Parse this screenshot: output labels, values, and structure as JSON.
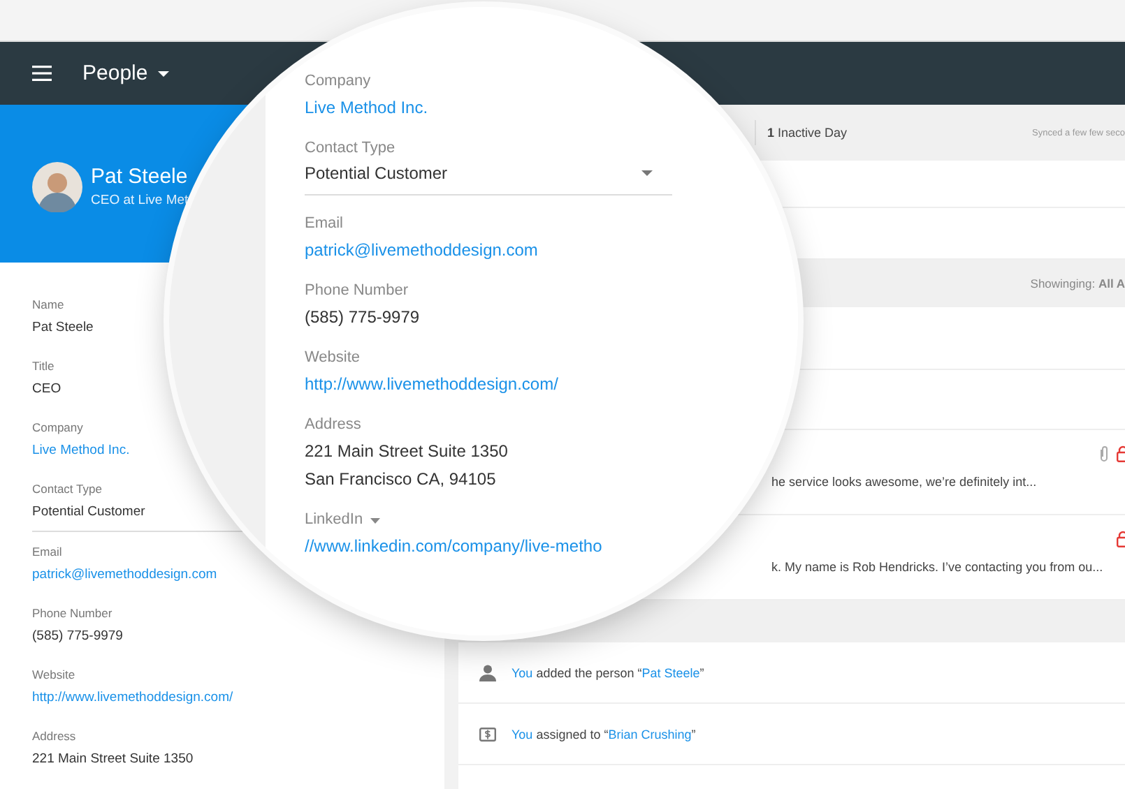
{
  "header": {
    "title": "People"
  },
  "profile": {
    "name": "Pat Steele",
    "subtitle": "CEO at Live Met"
  },
  "fields": [
    {
      "label": "Name",
      "kind": "text",
      "value": "Pat Steele"
    },
    {
      "label": "Title",
      "kind": "text",
      "value": "CEO"
    },
    {
      "label": "Company",
      "kind": "link",
      "value": "Live Method Inc."
    },
    {
      "label": "Contact Type",
      "kind": "select",
      "value": "Potential Customer"
    },
    {
      "label": "Email",
      "kind": "link",
      "value": "patrick@livemethoddesign.com"
    },
    {
      "label": "Phone Number",
      "kind": "text",
      "value": "(585) 775-9979"
    },
    {
      "label": "Website",
      "kind": "link",
      "value": "http://www.livemethoddesign.com/"
    },
    {
      "label": "Address",
      "kind": "text",
      "value": "221 Main Street Suite 1350"
    }
  ],
  "status_strip": {
    "inactive_count": "1",
    "inactive_label": "Inactive Day",
    "sync": "Synced a few few seco"
  },
  "filter": {
    "text": "Showinging: **All A**"
  },
  "messages": [
    {
      "preview": "he service looks awesome, we’re definitely int...",
      "attachment": true,
      "locked": true
    },
    {
      "preview": "k. My name is Rob Hendricks. I’ve contacting you from ou...",
      "attachment": false,
      "locked": true
    }
  ],
  "activity": [
    {
      "kind": "person",
      "actor": "You",
      "action": "added the person “",
      "target": "Pat Steele",
      "after": "”"
    },
    {
      "kind": "deal",
      "actor": "You",
      "action": "assigned to “",
      "target": "Brian Crushing",
      "after": "”"
    }
  ],
  "magnifier": {
    "fields": [
      {
        "label": "Company",
        "kind": "link",
        "value": "Live Method Inc."
      },
      {
        "label": "Contact Type",
        "kind": "select",
        "value": "Potential Customer"
      },
      {
        "label": "Email",
        "kind": "link",
        "value": "patrick@livemethoddesign.com"
      },
      {
        "label": "Phone Number",
        "kind": "text",
        "value": "(585) 775-9979"
      },
      {
        "label": "Website",
        "kind": "link",
        "value": "http://www.livemethoddesign.com/"
      },
      {
        "label": "Address",
        "kind": "lines",
        "lines": [
          "221 Main Street Suite 1350",
          "San Francisco CA, 94105"
        ]
      },
      {
        "label": "LinkedIn",
        "kind": "link-menu",
        "value": "//www.linkedin.com/company/live-metho"
      }
    ]
  }
}
